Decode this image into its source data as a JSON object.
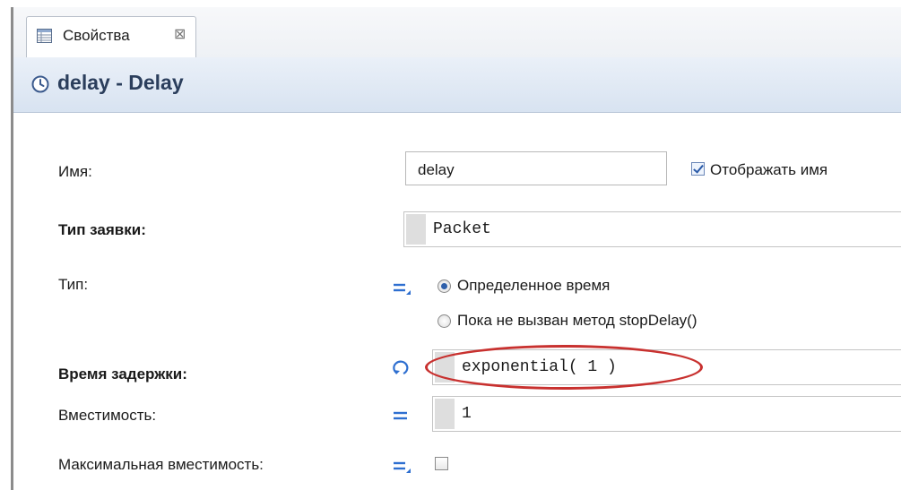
{
  "tab": {
    "label": "Свойства",
    "close_symbol": "⊠",
    "icon": "properties-grid-icon"
  },
  "header": {
    "title": "delay - Delay",
    "icon": "delay-clock-icon"
  },
  "form": {
    "name_label": "Имя:",
    "name_value": "delay",
    "show_name_label": "Отображать имя",
    "show_name_checked": true,
    "agent_type_label": "Тип заявки:",
    "agent_type_value": "Packet",
    "type_label": "Тип:",
    "type_options": [
      {
        "label": "Определенное время",
        "selected": true
      },
      {
        "label": "Пока не вызван метод stopDelay()",
        "selected": false
      }
    ],
    "delay_time_label": "Время задержки:",
    "delay_time_value": "exponential( 1 )",
    "delay_time_icon": "dynamic-value-icon",
    "capacity_label": "Вместимость:",
    "capacity_value": "1",
    "max_capacity_label": "Максимальная вместимость:",
    "max_capacity_checked": false
  },
  "colors": {
    "highlight_oval": "#c8312f",
    "title_text": "#2b3e5c",
    "accent": "#2e6fd0"
  }
}
